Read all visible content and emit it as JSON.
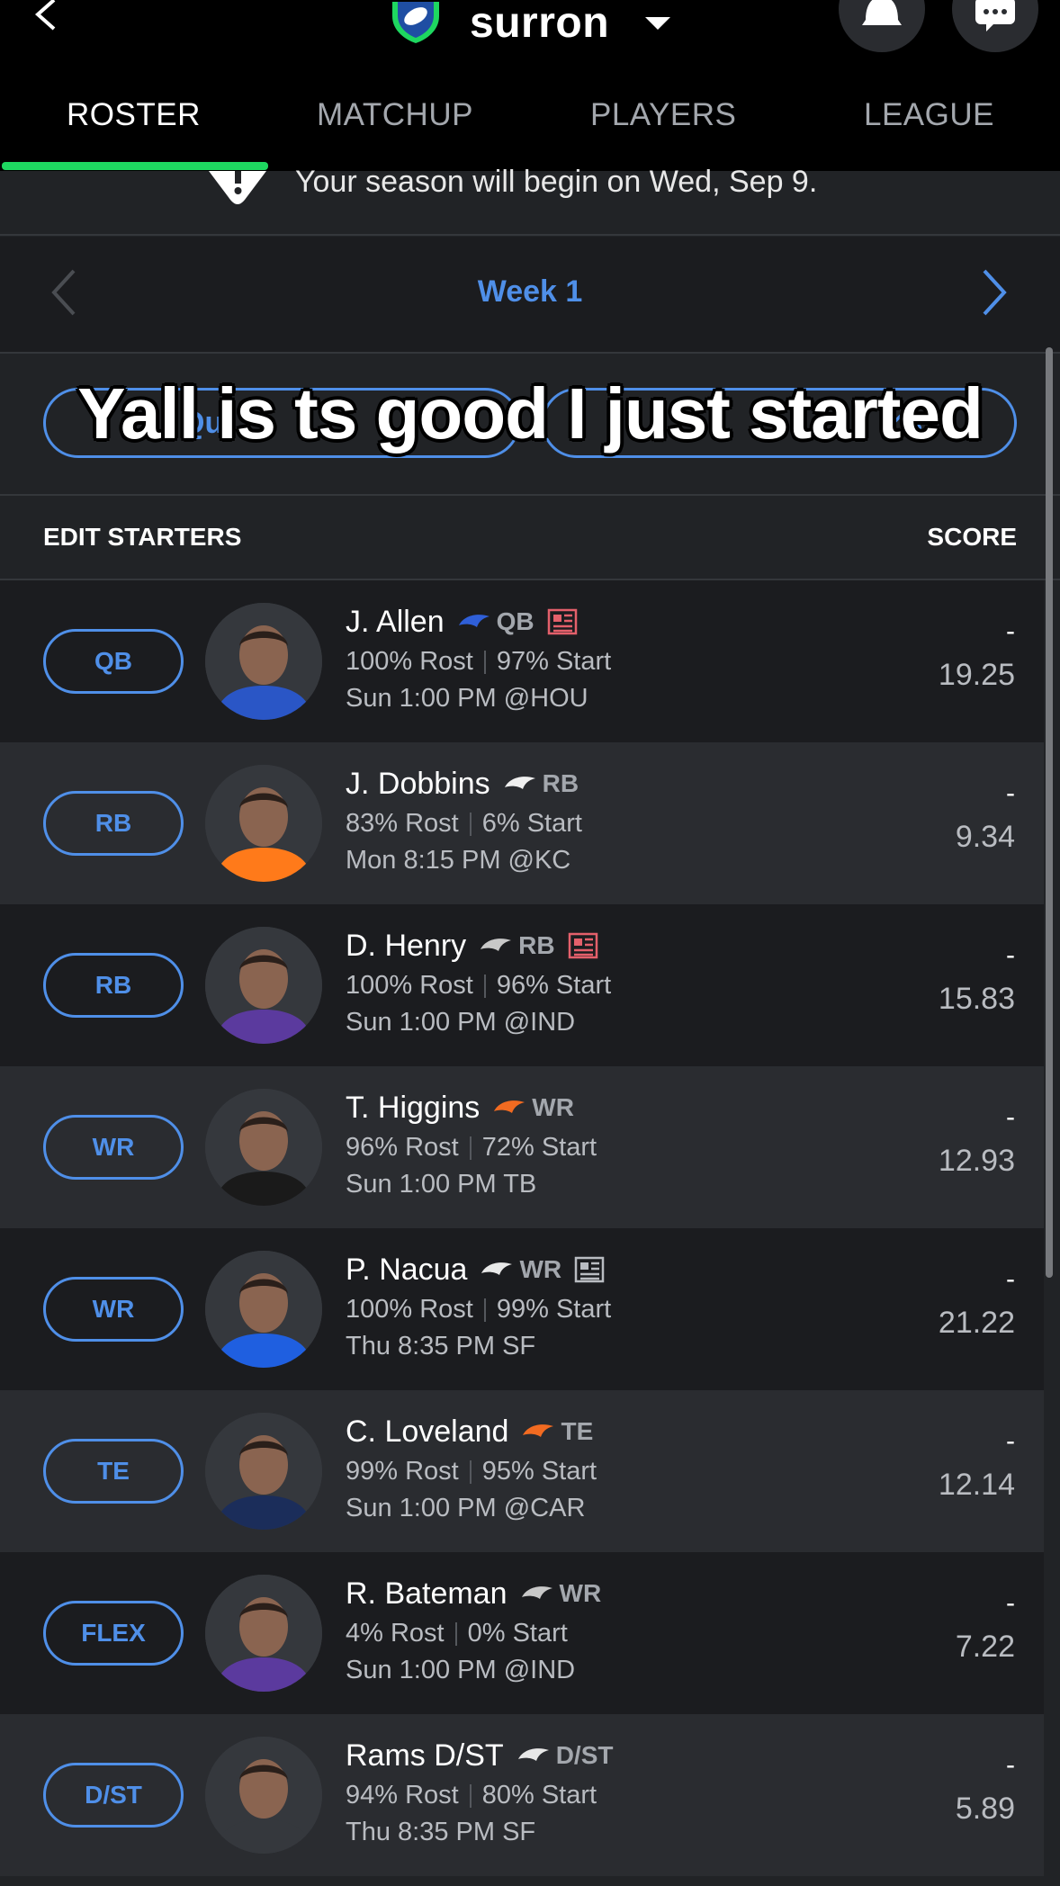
{
  "header": {
    "brand_name": "surron",
    "tabs": [
      "ROSTER",
      "MATCHUP",
      "PLAYERS",
      "LEAGUE"
    ],
    "active_tab": "ROSTER"
  },
  "notice": {
    "text": "Your season will begin on Wed, Sep 9."
  },
  "week": {
    "label": "Week 1"
  },
  "actions": {
    "left_label": "Qu",
    "right_label": "s"
  },
  "overlay_text": "Yall is ts good I just started",
  "table": {
    "left_header": "EDIT STARTERS",
    "right_header": "SCORE"
  },
  "players": [
    {
      "slot": "QB",
      "name": "J. Allen",
      "pos": "QB",
      "team": "BUF",
      "team_color": "#2f5fd8",
      "jersey": "#2a56c6",
      "has_news": true,
      "news_color": "#e4606b",
      "rost": "100% Rost",
      "start": "97% Start",
      "game": "Sun 1:00 PM @HOU",
      "score": "-",
      "proj": "19.25"
    },
    {
      "slot": "RB",
      "name": "J. Dobbins",
      "pos": "RB",
      "team": "DEN",
      "team_color": "#f0f0f0",
      "jersey": "#ff7a1a",
      "has_news": false,
      "rost": "83% Rost",
      "start": "6% Start",
      "game": "Mon 8:15 PM @KC",
      "score": "-",
      "proj": "9.34"
    },
    {
      "slot": "RB",
      "name": "D. Henry",
      "pos": "RB",
      "team": "BAL",
      "team_color": "#c8c8c8",
      "jersey": "#5b3a9e",
      "has_news": true,
      "news_color": "#e4606b",
      "rost": "100% Rost",
      "start": "96% Start",
      "game": "Sun 1:00 PM @IND",
      "score": "-",
      "proj": "15.83"
    },
    {
      "slot": "WR",
      "name": "T. Higgins",
      "pos": "WR",
      "team": "CIN",
      "team_color": "#f26b21",
      "jersey": "#1a1a1a",
      "has_news": false,
      "rost": "96% Rost",
      "start": "72% Start",
      "game": "Sun 1:00 PM TB",
      "score": "-",
      "proj": "12.93"
    },
    {
      "slot": "WR",
      "name": "P. Nacua",
      "pos": "WR",
      "team": "LAR",
      "team_color": "#e8e8e8",
      "jersey": "#1f5fe0",
      "has_news": true,
      "news_color": "#b9bcc1",
      "rost": "100% Rost",
      "start": "99% Start",
      "game": "Thu 8:35 PM SF",
      "score": "-",
      "proj": "21.22"
    },
    {
      "slot": "TE",
      "name": "C. Loveland",
      "pos": "TE",
      "team": "CHI",
      "team_color": "#f26b21",
      "jersey": "#1b2d5a",
      "has_news": false,
      "rost": "99% Rost",
      "start": "95% Start",
      "game": "Sun 1:00 PM @CAR",
      "score": "-",
      "proj": "12.14"
    },
    {
      "slot": "FLEX",
      "name": "R. Bateman",
      "pos": "WR",
      "team": "BAL",
      "team_color": "#c8c8c8",
      "jersey": "#5b3a9e",
      "has_news": false,
      "rost": "4% Rost",
      "start": "0% Start",
      "game": "Sun 1:00 PM @IND",
      "score": "-",
      "proj": "7.22"
    },
    {
      "slot": "D/ST",
      "name": "Rams D/ST",
      "pos": "D/ST",
      "team": "LAR",
      "team_color": "#e8e8e8",
      "jersey": "#35383d",
      "has_news": false,
      "rost": "94% Rost",
      "start": "80% Start",
      "game": "Thu 8:35 PM SF",
      "score": "-",
      "proj": "5.89"
    }
  ]
}
